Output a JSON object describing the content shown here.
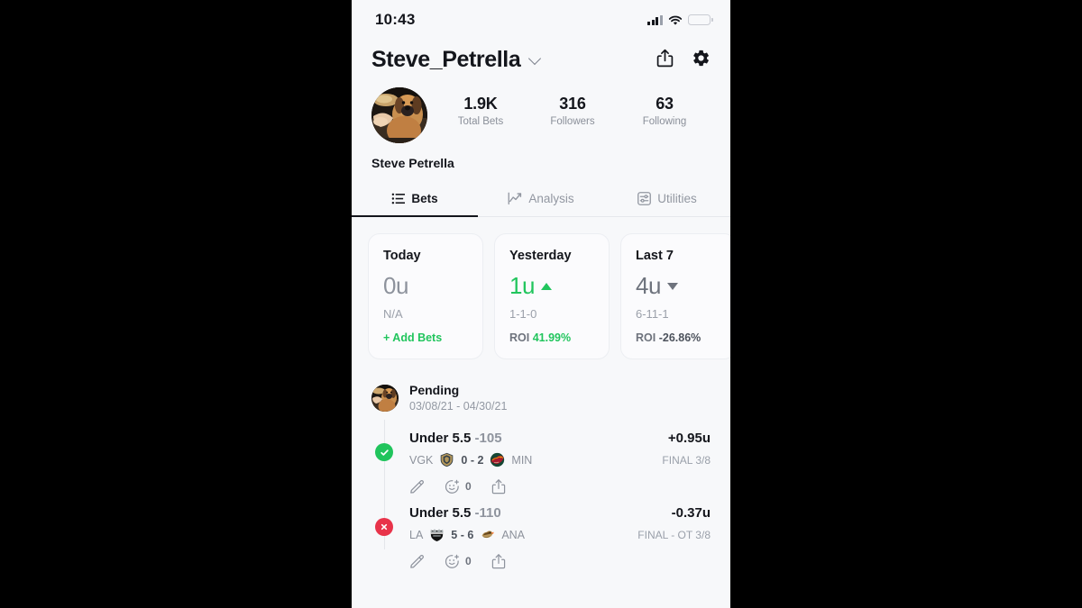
{
  "status_bar": {
    "time": "10:43",
    "signal_icon": "cellular-signal-icon",
    "wifi_icon": "wifi-icon",
    "battery_icon": "battery-low-power-icon",
    "battery_color": "#f6d34a"
  },
  "header": {
    "username": "Steve_Petrella",
    "dropdown_icon": "chevron-down-icon",
    "share_icon": "share-icon",
    "settings_icon": "gear-icon"
  },
  "profile": {
    "avatar_icon": "user-avatar-dog-photo",
    "full_name": "Steve Petrella",
    "stats": [
      {
        "value": "1.9K",
        "label": "Total Bets"
      },
      {
        "value": "316",
        "label": "Followers"
      },
      {
        "value": "63",
        "label": "Following"
      }
    ]
  },
  "tabs": [
    {
      "label": "Bets",
      "icon": "list-icon",
      "active": true
    },
    {
      "label": "Analysis",
      "icon": "line-chart-icon",
      "active": false
    },
    {
      "label": "Utilities",
      "icon": "sliders-icon",
      "active": false
    }
  ],
  "summary_cards": [
    {
      "title": "Today",
      "value": "0u",
      "value_state": "neutral",
      "trend": "none",
      "record": "N/A",
      "footer_label": "",
      "footer_value": "",
      "action_label": "+ Add Bets"
    },
    {
      "title": "Yesterday",
      "value": "1u",
      "value_state": "positive",
      "trend": "up",
      "record": "1-1-0",
      "footer_label": "ROI",
      "footer_value": "41.99%",
      "footer_value_state": "green",
      "action_label": ""
    },
    {
      "title": "Last 7",
      "value": "4u",
      "value_state": "negative",
      "trend": "down",
      "record": "6-11-1",
      "footer_label": "ROI",
      "footer_value": "-26.86%",
      "footer_value_state": "dark",
      "action_label": ""
    }
  ],
  "feed": {
    "avatar_icon": "user-avatar-dog-photo",
    "title": "Pending",
    "date_range": "03/08/21 - 04/30/21",
    "bets": [
      {
        "status": "win",
        "status_icon": "check-circle-icon",
        "name": "Under 5.5",
        "odds": "-105",
        "amount": "+0.95u",
        "away_team": "VGK",
        "away_logo": "vegas-golden-knights-logo",
        "score": "0 - 2",
        "home_team": "MIN",
        "home_logo": "minnesota-wild-logo",
        "final": "FINAL 3/8",
        "edit_icon": "pencil-icon",
        "react_icon": "add-reaction-icon",
        "react_count": "0",
        "share_icon": "share-icon"
      },
      {
        "status": "loss",
        "status_icon": "x-circle-icon",
        "name": "Under 5.5",
        "odds": "-110",
        "amount": "-0.37u",
        "away_team": "LA",
        "away_logo": "los-angeles-kings-logo",
        "score": "5 - 6",
        "home_team": "ANA",
        "home_logo": "anaheim-ducks-logo",
        "final": "FINAL - OT 3/8",
        "edit_icon": "pencil-icon",
        "react_icon": "add-reaction-icon",
        "react_count": "0",
        "share_icon": "share-icon"
      }
    ]
  },
  "colors": {
    "accent_green": "#21c55d",
    "loss_red": "#e8334a",
    "text_primary": "#14161c",
    "text_muted": "#8f949e",
    "background": "#f7f8fa"
  }
}
